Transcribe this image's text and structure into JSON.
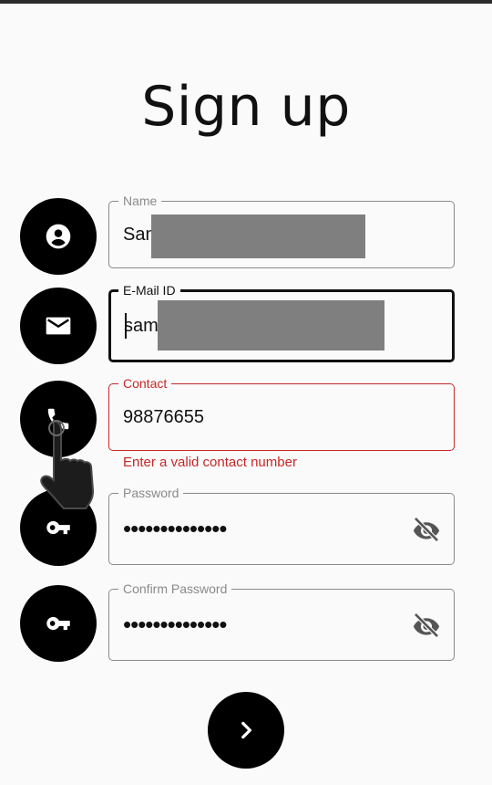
{
  "page": {
    "title": "Sign up"
  },
  "form": {
    "name": {
      "label": "Name",
      "value": "San",
      "icon": "account-circle-icon"
    },
    "email": {
      "label": "E-Mail ID",
      "value": "sam",
      "icon": "mail-icon"
    },
    "contact": {
      "label": "Contact",
      "value": "98876655",
      "error": "Enter a valid contact number",
      "icon": "phone-icon"
    },
    "password": {
      "label": "Password",
      "value": "••••••••••••••",
      "icon": "key-icon"
    },
    "confirm_password": {
      "label": "Confirm Password",
      "value": "••••••••••••••",
      "icon": "key-icon"
    }
  },
  "colors": {
    "error": "#c62828",
    "accent": "#000000",
    "border": "#8a8a8a",
    "background": "#fafafa"
  }
}
